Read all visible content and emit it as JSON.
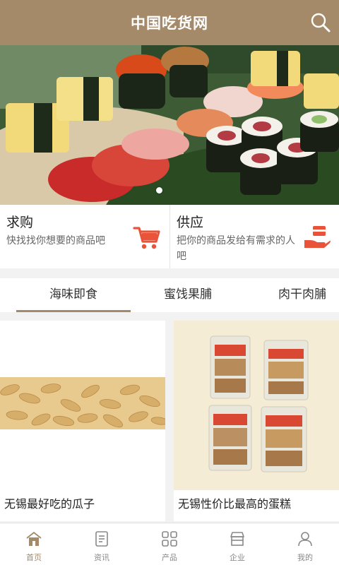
{
  "header": {
    "title": "中国吃货网"
  },
  "tiles": [
    {
      "title": "求购",
      "desc": "快找找你想要的商品吧",
      "icon": "cart-icon"
    },
    {
      "title": "供应",
      "desc": "把你的商品发给有需求的人吧",
      "icon": "hand-gift-icon"
    }
  ],
  "tabs": [
    {
      "label": "海味即食",
      "active": true
    },
    {
      "label": "蜜饯果脯",
      "active": false
    },
    {
      "label": "肉干肉脯",
      "active": false
    }
  ],
  "products": [
    {
      "title": "无锡最好吃的瓜子",
      "image": "sunflower-seeds-photo"
    },
    {
      "title": "无锡性价比最高的蛋糕",
      "image": "packaged-cakes-photo"
    }
  ],
  "nav": [
    {
      "label": "首页",
      "icon": "home-icon",
      "active": true
    },
    {
      "label": "资讯",
      "icon": "news-icon",
      "active": false
    },
    {
      "label": "产品",
      "icon": "grid-icon",
      "active": false
    },
    {
      "label": "企业",
      "icon": "store-icon",
      "active": false
    },
    {
      "label": "我的",
      "icon": "user-icon",
      "active": false
    }
  ],
  "colors": {
    "brand": "#a48a68",
    "accent": "#e8533a",
    "background": "#f2f2f2"
  }
}
